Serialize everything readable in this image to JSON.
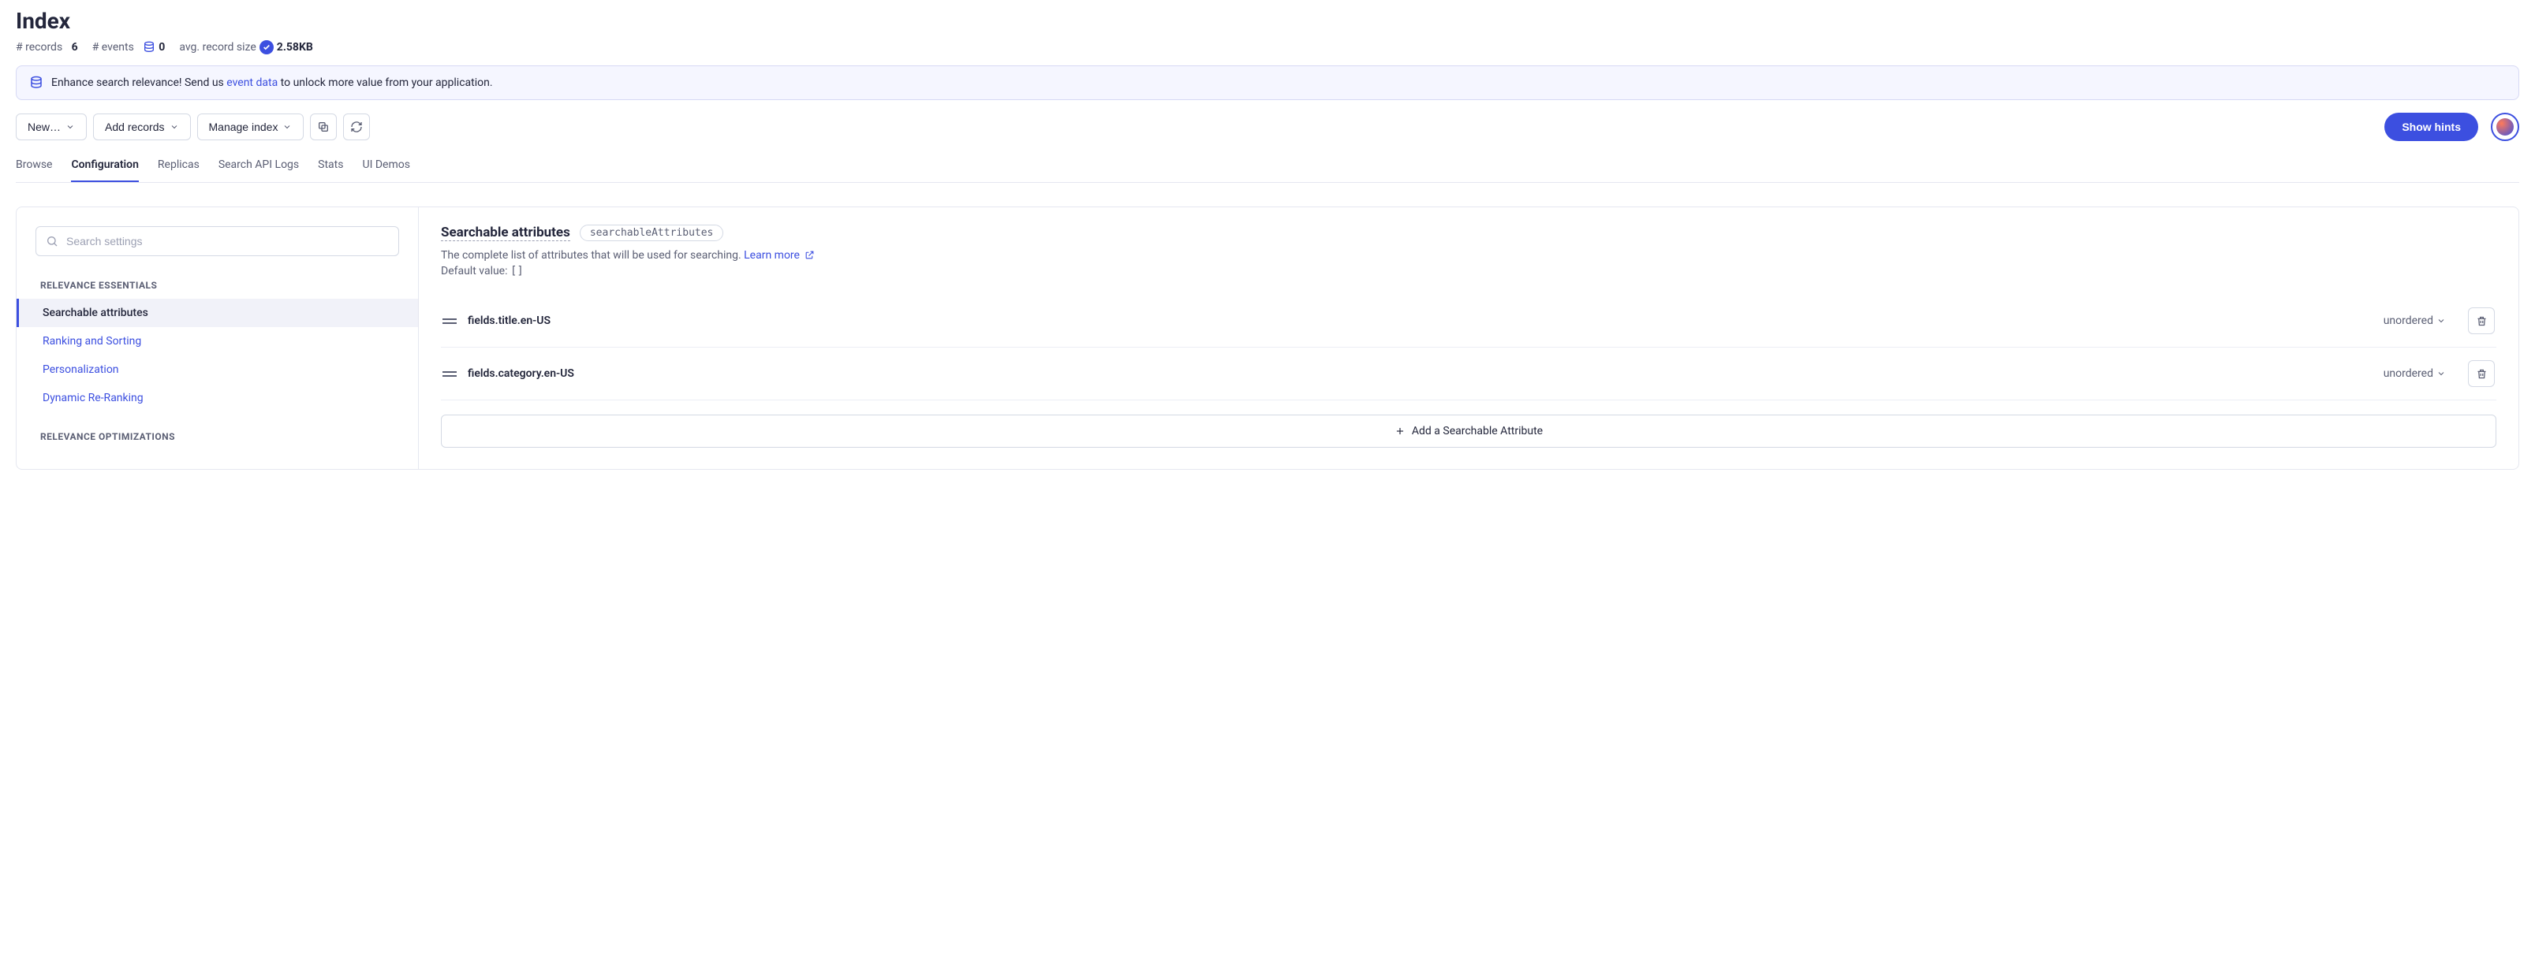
{
  "header": {
    "title": "Index",
    "records_label": "# records",
    "records_value": "6",
    "events_label": "# events",
    "events_value": "0",
    "avg_label": "avg. record size",
    "avg_value": "2.58KB"
  },
  "banner": {
    "pre": "Enhance search relevance! Send us ",
    "link": "event data",
    "post": " to unlock more value from your application."
  },
  "toolbar": {
    "new_label": "New…",
    "add_records_label": "Add records",
    "manage_index_label": "Manage index",
    "show_hints_label": "Show hints"
  },
  "tabs": [
    {
      "id": "browse",
      "label": "Browse",
      "active": false
    },
    {
      "id": "configuration",
      "label": "Configuration",
      "active": true
    },
    {
      "id": "replicas",
      "label": "Replicas",
      "active": false
    },
    {
      "id": "search-api-logs",
      "label": "Search API Logs",
      "active": false
    },
    {
      "id": "stats",
      "label": "Stats",
      "active": false
    },
    {
      "id": "ui-demos",
      "label": "UI Demos",
      "active": false
    }
  ],
  "settings_search": {
    "placeholder": "Search settings"
  },
  "sidebar": {
    "section1": "RELEVANCE ESSENTIALS",
    "items1": [
      {
        "label": "Searchable attributes",
        "active": true
      },
      {
        "label": "Ranking and Sorting",
        "active": false
      },
      {
        "label": "Personalization",
        "active": false
      },
      {
        "label": "Dynamic Re-Ranking",
        "active": false
      }
    ],
    "section2": "RELEVANCE OPTIMIZATIONS"
  },
  "main": {
    "title": "Searchable attributes",
    "chip": "searchableAttributes",
    "desc": "The complete list of attributes that will be used for searching. ",
    "learn_more": "Learn more",
    "default_label": "Default value:  ",
    "default_value": "[]",
    "attributes": [
      {
        "name": "fields.title.en-US",
        "order": "unordered"
      },
      {
        "name": "fields.category.en-US",
        "order": "unordered"
      }
    ],
    "add_label": "Add a Searchable Attribute"
  }
}
